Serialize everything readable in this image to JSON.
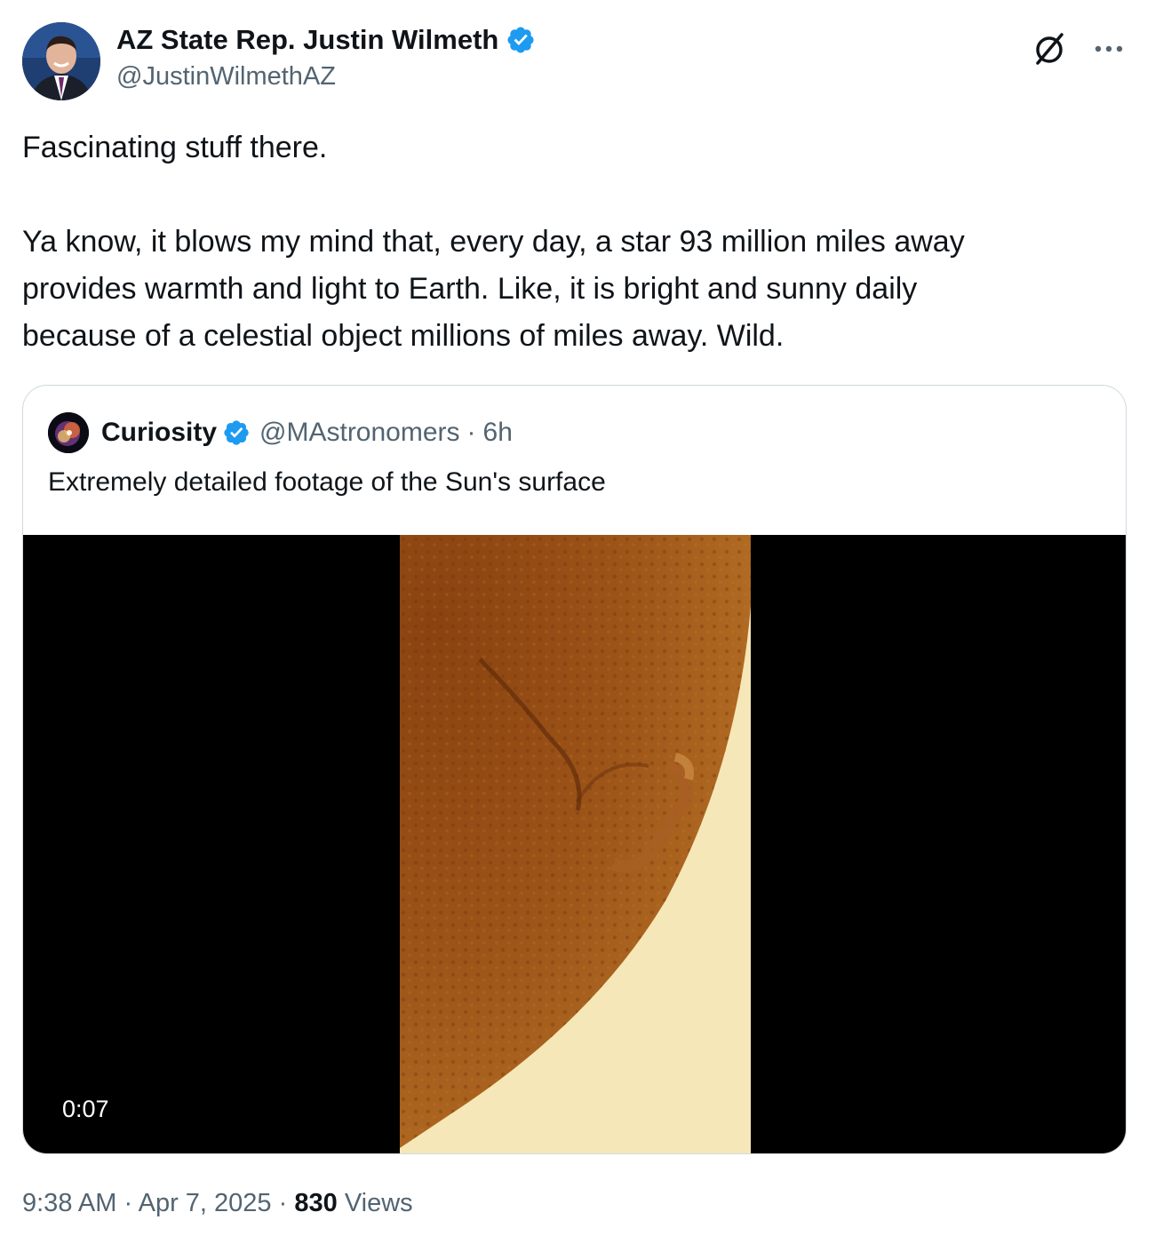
{
  "author": {
    "display_name": "AZ State Rep. Justin Wilmeth",
    "handle": "@JustinWilmethAZ",
    "verified": true,
    "avatar_icon": "profile-photo"
  },
  "actions": {
    "grok_icon": "grok-icon",
    "more_icon": "more-horizontal-icon"
  },
  "tweet": {
    "text": "Fascinating stuff there.\n\nYa know, it blows my mind that, every day, a star 93 million miles away\nprovides warmth and light to Earth. Like, it is bright and sunny daily\nbecause of a celestial object millions of miles away. Wild."
  },
  "quote": {
    "display_name": "Curiosity",
    "handle": "@MAstronomers",
    "separator": "·",
    "time_ago": "6h",
    "verified": true,
    "text": "Extremely detailed footage of the Sun's surface",
    "video_duration": "0:07"
  },
  "meta": {
    "time": "9:38 AM",
    "sep1": "·",
    "date": "Apr 7, 2025",
    "sep2": "·",
    "views_count": "830",
    "views_label": "Views"
  },
  "colors": {
    "verified_blue": "#1d9bf0",
    "secondary_text": "#536471",
    "primary_text": "#0f1419",
    "border": "#cfd9de"
  }
}
